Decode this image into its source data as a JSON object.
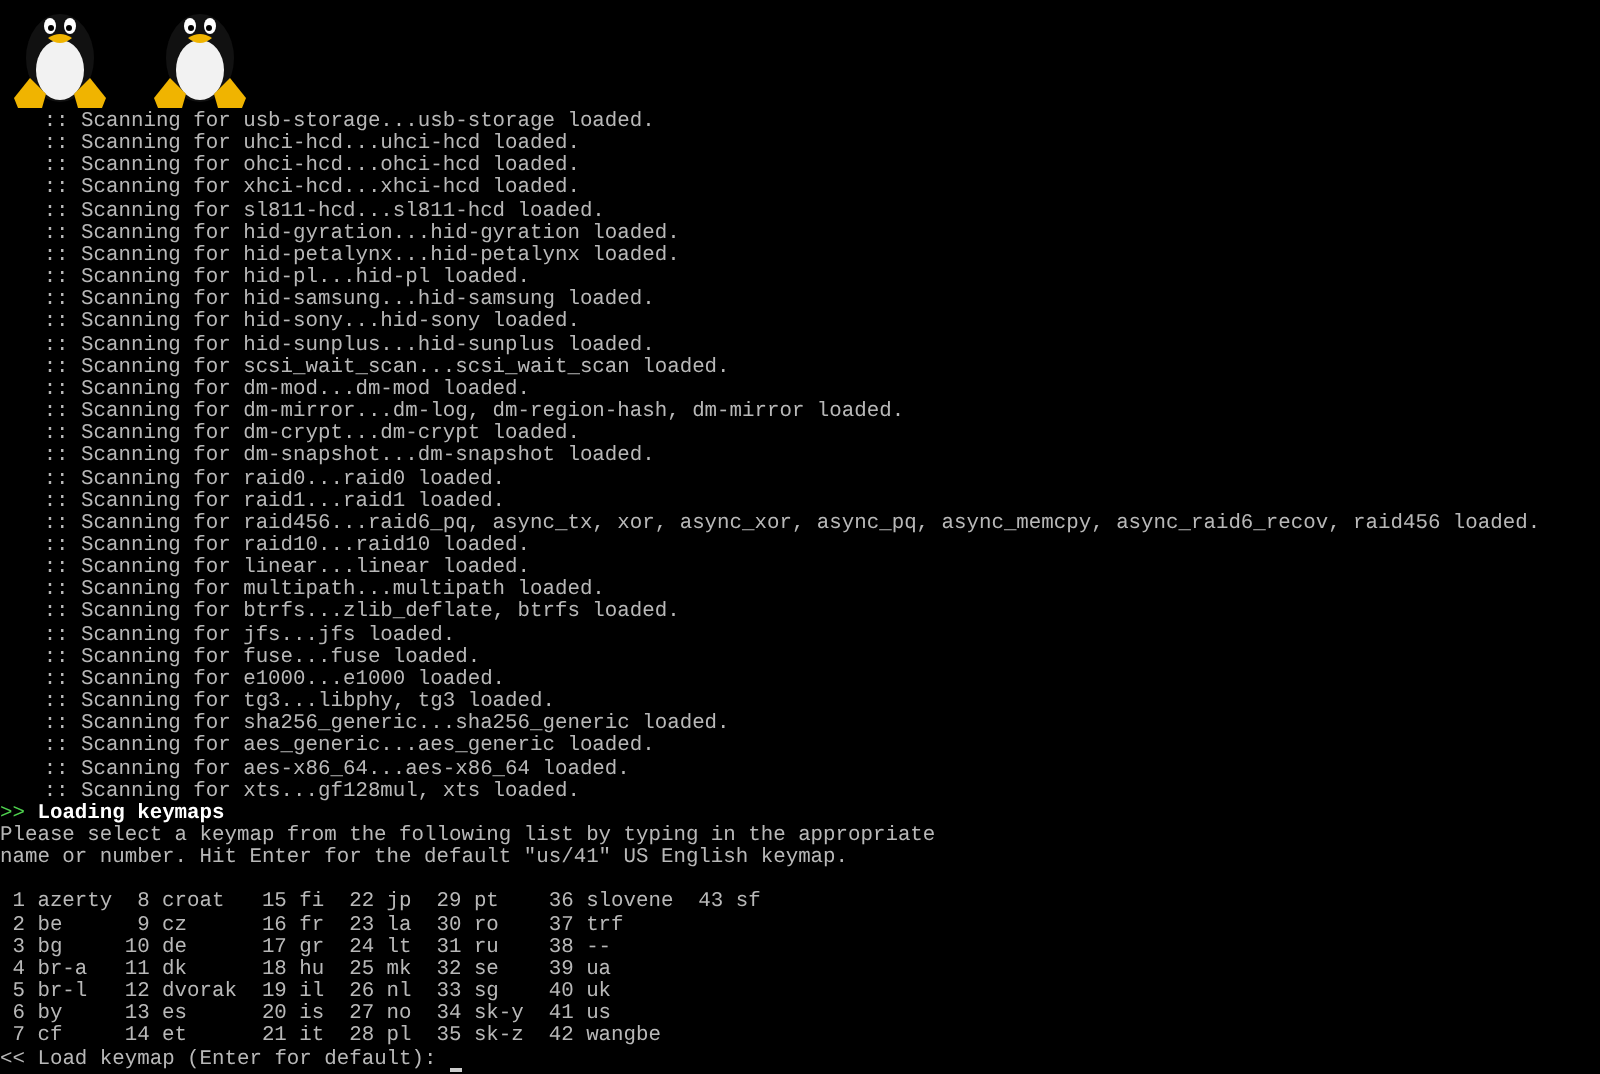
{
  "boot_log": [
    {
      "marker": "::",
      "text": "Scanning for usb-storage...usb-storage loaded."
    },
    {
      "marker": "::",
      "text": "Scanning for uhci-hcd...uhci-hcd loaded."
    },
    {
      "marker": "::",
      "text": "Scanning for ohci-hcd...ohci-hcd loaded."
    },
    {
      "marker": "::",
      "text": "Scanning for xhci-hcd...xhci-hcd loaded."
    },
    {
      "marker": "::",
      "text": "Scanning for sl811-hcd...sl811-hcd loaded."
    },
    {
      "marker": "::",
      "text": "Scanning for hid-gyration...hid-gyration loaded."
    },
    {
      "marker": "::",
      "text": "Scanning for hid-petalynx...hid-petalynx loaded."
    },
    {
      "marker": "::",
      "text": "Scanning for hid-pl...hid-pl loaded."
    },
    {
      "marker": "::",
      "text": "Scanning for hid-samsung...hid-samsung loaded."
    },
    {
      "marker": "::",
      "text": "Scanning for hid-sony...hid-sony loaded."
    },
    {
      "marker": "::",
      "text": "Scanning for hid-sunplus...hid-sunplus loaded."
    },
    {
      "marker": "::",
      "text": "Scanning for scsi_wait_scan...scsi_wait_scan loaded."
    },
    {
      "marker": "::",
      "text": "Scanning for dm-mod...dm-mod loaded."
    },
    {
      "marker": "::",
      "text": "Scanning for dm-mirror...dm-log, dm-region-hash, dm-mirror loaded."
    },
    {
      "marker": "::",
      "text": "Scanning for dm-crypt...dm-crypt loaded."
    },
    {
      "marker": "::",
      "text": "Scanning for dm-snapshot...dm-snapshot loaded."
    },
    {
      "marker": "::",
      "text": "Scanning for raid0...raid0 loaded."
    },
    {
      "marker": "::",
      "text": "Scanning for raid1...raid1 loaded."
    },
    {
      "marker": "::",
      "text": "Scanning for raid456...raid6_pq, async_tx, xor, async_xor, async_pq, async_memcpy, async_raid6_recov, raid456 loaded."
    },
    {
      "marker": "::",
      "text": "Scanning for raid10...raid10 loaded."
    },
    {
      "marker": "::",
      "text": "Scanning for linear...linear loaded."
    },
    {
      "marker": "::",
      "text": "Scanning for multipath...multipath loaded."
    },
    {
      "marker": "::",
      "text": "Scanning for btrfs...zlib_deflate, btrfs loaded."
    },
    {
      "marker": "::",
      "text": "Scanning for jfs...jfs loaded."
    },
    {
      "marker": "::",
      "text": "Scanning for fuse...fuse loaded."
    },
    {
      "marker": "::",
      "text": "Scanning for e1000...e1000 loaded."
    },
    {
      "marker": "::",
      "text": "Scanning for tg3...libphy, tg3 loaded."
    },
    {
      "marker": "::",
      "text": "Scanning for sha256_generic...sha256_generic loaded."
    },
    {
      "marker": "::",
      "text": "Scanning for aes_generic...aes_generic loaded."
    },
    {
      "marker": "::",
      "text": "Scanning for aes-x86_64...aes-x86_64 loaded."
    },
    {
      "marker": "::",
      "text": "Scanning for xts...gf128mul, xts loaded."
    }
  ],
  "section": {
    "marker": ">>",
    "title": "Loading keymaps"
  },
  "message": [
    "Please select a keymap from the following list by typing in the appropriate",
    "name or number. Hit Enter for the default \"us/41\" US English keymap."
  ],
  "keymap_rows": [
    "1 azerty  8 croat   15 fi  22 jp  29 pt    36 slovene  43 sf",
    "2 be      9 cz      16 fr  23 la  30 ro    37 trf",
    "3 bg     10 de      17 gr  24 lt  31 ru    38 --",
    "4 br-a   11 dk      18 hu  25 mk  32 se    39 ua",
    "5 br-l   12 dvorak  19 il  26 nl  33 sg    40 uk",
    "6 by     13 es      20 is  27 no  34 sk-y  41 us",
    "7 cf     14 et      21 it  28 pl  35 sk-z  42 wangbe"
  ],
  "prompt": {
    "marker": "<<",
    "text": "Load keymap (Enter for default):"
  }
}
